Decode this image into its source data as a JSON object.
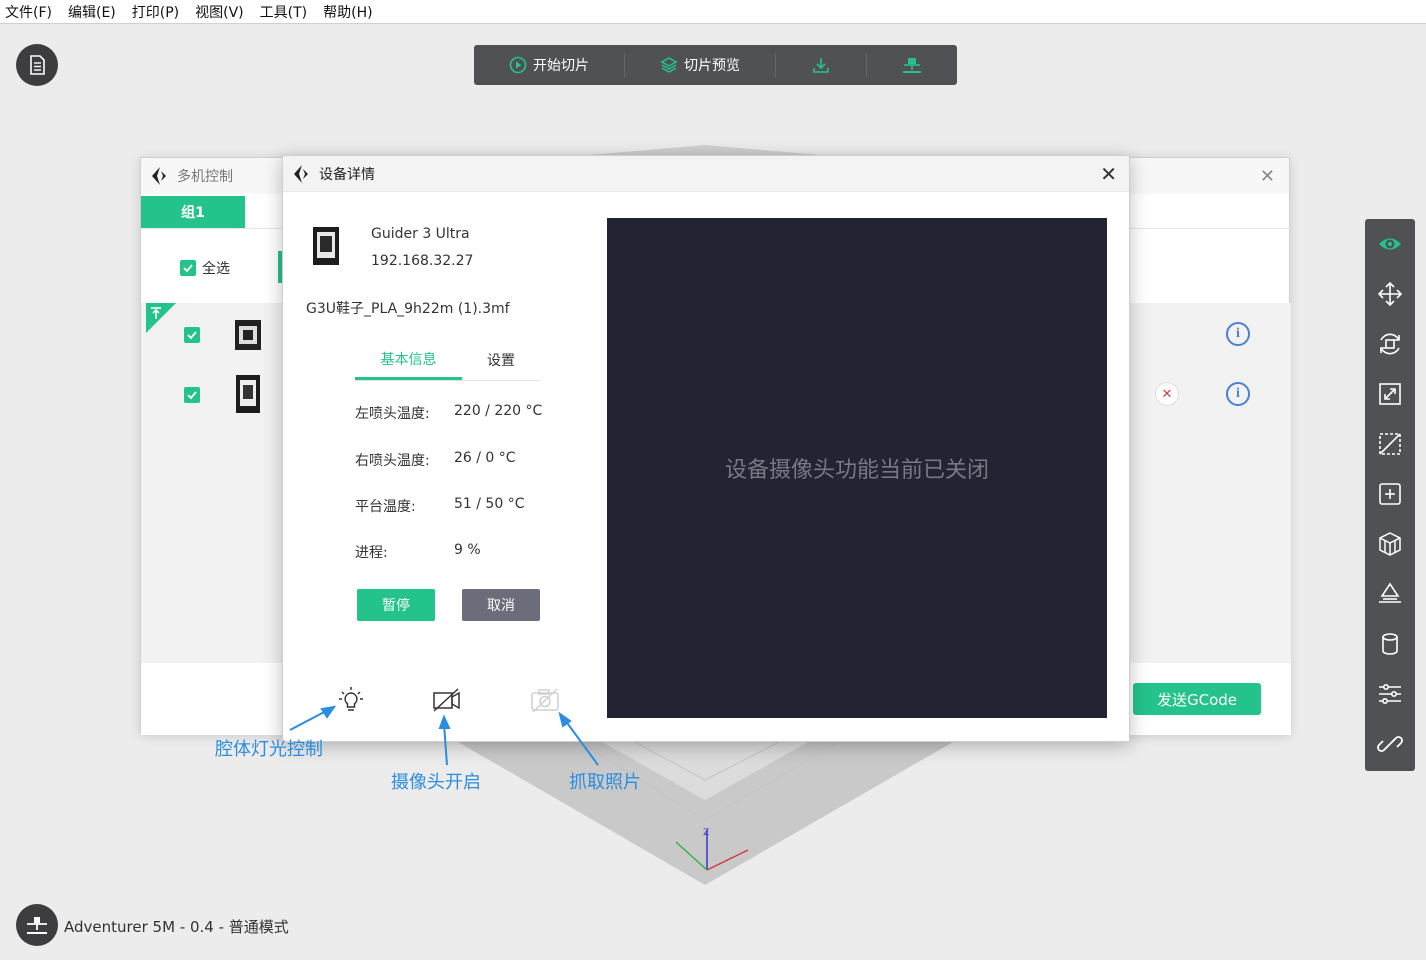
{
  "menu": [
    "文件(F)",
    "编辑(E)",
    "打印(P)",
    "视图(V)",
    "工具(T)",
    "帮助(H)"
  ],
  "toolbar": {
    "slice_label": "开始切片",
    "preview_label": "切片预览"
  },
  "multi_window": {
    "title": "多机控制",
    "tab": "组1",
    "select_all": "全选",
    "send_gcode": "发送GCode"
  },
  "dialog": {
    "title": "设备详情",
    "device_name": "Guider 3 Ultra",
    "device_ip": "192.168.32.27",
    "file_name": "G3U鞋子_PLA_9h22m (1).3mf",
    "tab_basic": "基本信息",
    "tab_settings": "设置",
    "left_nozzle_label": "左喷头温度:",
    "left_nozzle_value": "220 / 220 °C",
    "right_nozzle_label": "右喷头温度:",
    "right_nozzle_value": "26 / 0 °C",
    "bed_label": "平台温度:",
    "bed_value": "51 / 50 °C",
    "progress_label": "进程:",
    "progress_value": "9 %",
    "pause": "暂停",
    "cancel": "取消",
    "camera_message": "设备摄像头功能当前已关闭"
  },
  "annotations": {
    "light": "腔体灯光控制",
    "camera": "摄像头开启",
    "capture": "抓取照片"
  },
  "status": {
    "printer": "Adventurer 5M - 0.4 - 普通模式"
  },
  "colors": {
    "accent": "#23c38b",
    "annotation": "#2a8de0",
    "camera_bg": "#232433"
  }
}
